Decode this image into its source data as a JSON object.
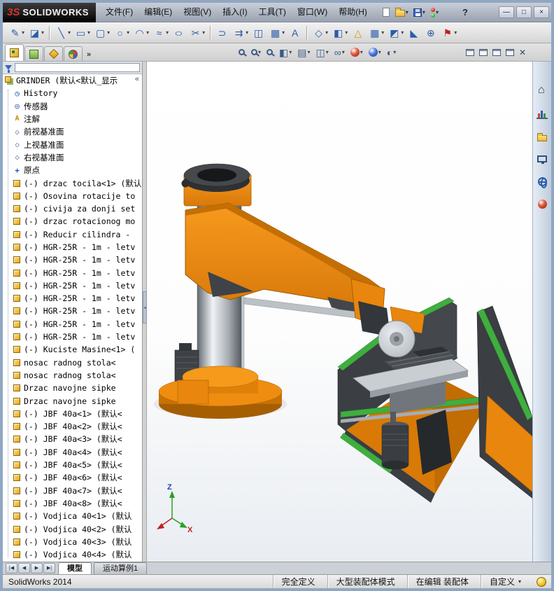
{
  "colors": {
    "accent_orange": "#E8860D",
    "machine_dark": "#3B3E42",
    "rail_green": "#3FAE3F",
    "selection_blue": "#2A5CAA",
    "viewport_bg": "#FFFFFF",
    "titlebar_bg": "#AEB6C2"
  },
  "titlebar": {
    "logo_mark": "3S",
    "logo_text": "SOLIDWORKS",
    "menus": [
      "文件(F)",
      "编辑(E)",
      "视图(V)",
      "插入(I)",
      "工具(T)",
      "窗口(W)",
      "帮助(H)"
    ],
    "quick_icons": [
      {
        "name": "new-document-icon",
        "icls": "page"
      },
      {
        "name": "open-document-icon",
        "icls": "folder",
        "caret": "▾"
      },
      {
        "name": "save-icon",
        "icls": "floppy",
        "caret": "▾"
      },
      {
        "name": "rebuild-traffic-icon",
        "icls": "traffic",
        "caret": "▾"
      }
    ],
    "help_label": "?",
    "window_buttons": [
      {
        "name": "minimize-button",
        "glyph": "—"
      },
      {
        "name": "maximize-button",
        "glyph": "□"
      },
      {
        "name": "close-button",
        "glyph": "×"
      }
    ]
  },
  "toolbar": {
    "items": [
      {
        "name": "edit-sketch-icon",
        "glyph": "✎",
        "caret": "▾"
      },
      {
        "name": "eraser-icon",
        "glyph": "◪",
        "caret": "▾"
      },
      {
        "name": "toolbar-separator",
        "cls": "sep"
      },
      {
        "name": "line-icon",
        "glyph": "╲",
        "caret": "▾"
      },
      {
        "name": "rectangle-icon",
        "glyph": "▭",
        "caret": "▾"
      },
      {
        "name": "slot-icon",
        "glyph": "▢",
        "caret": "▾"
      },
      {
        "name": "circle-icon",
        "glyph": "○",
        "caret": "▾"
      },
      {
        "name": "arc-icon",
        "glyph": "◠",
        "caret": "▾"
      },
      {
        "name": "spline-icon",
        "glyph": "≈",
        "caret": "▾"
      },
      {
        "name": "ellipse-icon",
        "glyph": "○",
        "cls": "wide"
      },
      {
        "name": "trim-entities-icon",
        "glyph": "✂",
        "caret": "▾"
      },
      {
        "name": "toolbar-separator",
        "cls": "sep"
      },
      {
        "name": "convert-entities-icon",
        "glyph": "⊃"
      },
      {
        "name": "offset-entities-icon",
        "glyph": "⇉",
        "caret": "▾"
      },
      {
        "name": "mirror-entities-icon",
        "glyph": "◫"
      },
      {
        "name": "linear-pattern-icon",
        "glyph": "▦",
        "caret": "▾"
      },
      {
        "name": "sketch-text-icon",
        "glyph": "A"
      },
      {
        "name": "toolbar-separator",
        "cls": "sep"
      },
      {
        "name": "reference-geometry-icon",
        "glyph": "◇",
        "caret": "▾"
      },
      {
        "name": "section-view-icon",
        "glyph": "◧",
        "caret": "▾"
      },
      {
        "name": "warning-triangle-icon",
        "glyph": "△",
        "cls": "amber"
      },
      {
        "name": "grid-icon",
        "glyph": "▦",
        "caret": "▾"
      },
      {
        "name": "display-style-icon",
        "glyph": "◩",
        "caret": "▾"
      },
      {
        "name": "chamfer-icon",
        "glyph": "◣"
      },
      {
        "name": "measure-icon",
        "glyph": "⊕"
      },
      {
        "name": "flag-icon",
        "glyph": "⚑",
        "cls": "red",
        "caret": "▾"
      }
    ]
  },
  "panel": {
    "tabs": [
      {
        "name": "tab-featuremanager",
        "icls": "fm",
        "cls": "active"
      },
      {
        "name": "tab-propertymanager",
        "icls": "pm"
      },
      {
        "name": "tab-configurationmanager",
        "icls": "cm"
      },
      {
        "name": "tab-displaymanager",
        "icls": "dm"
      }
    ],
    "overflow_label": "»",
    "collapse_label": "«",
    "tree_items": [
      {
        "icon": "assembly",
        "label": "GRINDER (默认<默认_显示"
      },
      {
        "icon": "history",
        "label": "History"
      },
      {
        "icon": "sensor",
        "label": "传感器"
      },
      {
        "icon": "annotation",
        "label": "注解"
      },
      {
        "icon": "plane",
        "label": "前视基准面"
      },
      {
        "icon": "plane",
        "label": "上视基准面"
      },
      {
        "icon": "plane",
        "label": "右视基准面"
      },
      {
        "icon": "origin",
        "label": "原点"
      },
      {
        "icon": "part",
        "label": "(-) drzac tocila<1> (默认"
      },
      {
        "icon": "part",
        "label": "(-) Osovina rotacije to"
      },
      {
        "icon": "part",
        "label": "(-) civija za donji set"
      },
      {
        "icon": "part",
        "label": "(-) drzac rotacionog mo"
      },
      {
        "icon": "part",
        "label": "(-) Reducir cilindra -"
      },
      {
        "icon": "part",
        "label": "(-) HGR-25R - 1m - letv"
      },
      {
        "icon": "part",
        "label": "(-) HGR-25R - 1m - letv"
      },
      {
        "icon": "part",
        "label": "(-) HGR-25R - 1m - letv"
      },
      {
        "icon": "part",
        "label": "(-) HGR-25R - 1m - letv"
      },
      {
        "icon": "part",
        "label": "(-) HGR-25R - 1m - letv"
      },
      {
        "icon": "part",
        "label": "(-) HGR-25R - 1m - letv"
      },
      {
        "icon": "part",
        "label": "(-) HGR-25R - 1m - letv"
      },
      {
        "icon": "part",
        "label": "(-) HGR-25R - 1m - letv"
      },
      {
        "icon": "part",
        "label": "(-) Kuciste Masine<1> ("
      },
      {
        "icon": "part",
        "label": "nosac radnog stola<"
      },
      {
        "icon": "part",
        "label": "nosac radnog stola<"
      },
      {
        "icon": "part",
        "label": "Drzac navojne sipke"
      },
      {
        "icon": "part",
        "label": "Drzac navojne sipke"
      },
      {
        "icon": "part",
        "label": "(-) JBF 40a<1> (默认<"
      },
      {
        "icon": "part",
        "label": "(-) JBF 40a<2> (默认<"
      },
      {
        "icon": "part",
        "label": "(-) JBF 40a<3> (默认<"
      },
      {
        "icon": "part",
        "label": "(-) JBF 40a<4> (默认<"
      },
      {
        "icon": "part",
        "label": "(-) JBF 40a<5> (默认<"
      },
      {
        "icon": "part",
        "label": "(-) JBF 40a<6> (默认<"
      },
      {
        "icon": "part",
        "label": "(-) JBF 40a<7> (默认<"
      },
      {
        "icon": "part",
        "label": "(-) JBF 40a<8> (默认<"
      },
      {
        "icon": "part",
        "label": "(-) Vodjica 40<1> (默认"
      },
      {
        "icon": "part",
        "label": "(-) Vodjica 40<2> (默认"
      },
      {
        "icon": "part",
        "label": "(-) Vodjica 40<3> (默认"
      },
      {
        "icon": "part",
        "label": "(-) Vodjica 40<4> (默认"
      }
    ]
  },
  "viewport": {
    "headsup": [
      {
        "name": "zoom-fit-icon",
        "icls": "magnifier"
      },
      {
        "name": "zoom-area-icon",
        "icls": "magnifier",
        "caret": "▾"
      },
      {
        "name": "zoom-in-out-icon",
        "icls": "magnifier"
      },
      {
        "name": "section-view-icon",
        "glyph": "◧",
        "caret": "▾"
      },
      {
        "name": "view-orientation-icon",
        "glyph": "▤",
        "caret": "▾"
      },
      {
        "name": "display-style-icon",
        "glyph": "◫",
        "caret": "▾"
      },
      {
        "name": "hide-show-items-icon",
        "glyph": "∞",
        "caret": "▾"
      },
      {
        "name": "edit-appearance-icon",
        "icls": "ball-red",
        "caret": "▾"
      },
      {
        "name": "apply-scene-icon",
        "icls": "ball-blue",
        "caret": "▾"
      },
      {
        "name": "view-settings-icon",
        "glyph": "◐",
        "caret": "▾"
      }
    ],
    "doc_controls": [
      {
        "name": "minimize-window-icon"
      },
      {
        "name": "restore-window-icon"
      },
      {
        "name": "cascade-windows-icon"
      },
      {
        "name": "tile-windows-icon"
      }
    ],
    "close_glyph": "✕",
    "triad": {
      "z_label": "Z",
      "x_label": "X"
    }
  },
  "task_pane": {
    "icons": [
      {
        "name": "home-icon",
        "icls": "house"
      },
      {
        "name": "bar-chart-icon",
        "icls": "chart"
      },
      {
        "name": "folder-icon",
        "icls": "folder"
      },
      {
        "name": "monitor-icon",
        "icls": "monitor"
      },
      {
        "name": "globe-icon",
        "icls": "globe"
      },
      {
        "name": "sphere-icon",
        "icls": "ball"
      }
    ]
  },
  "bottom_bar": {
    "nav": [
      {
        "name": "first-tab-button",
        "glyph": "|◀"
      },
      {
        "name": "prev-tab-button",
        "glyph": "◀"
      },
      {
        "name": "next-tab-button",
        "glyph": "▶"
      },
      {
        "name": "last-tab-button",
        "glyph": "▶|"
      }
    ],
    "tabs": [
      {
        "name": "tab-model",
        "label": "模型",
        "cls": "active"
      },
      {
        "name": "tab-motion-study",
        "label": "运动算例1"
      }
    ]
  },
  "statusbar": {
    "app": "SolidWorks 2014",
    "fields": [
      {
        "name": "status-definition",
        "text": "完全定义"
      },
      {
        "name": "status-assembly-mode",
        "text": "大型装配体模式"
      },
      {
        "name": "status-edit-state",
        "text": "在编辑 装配体"
      },
      {
        "name": "status-custom",
        "text": "自定义",
        "caret": "▾"
      }
    ]
  }
}
